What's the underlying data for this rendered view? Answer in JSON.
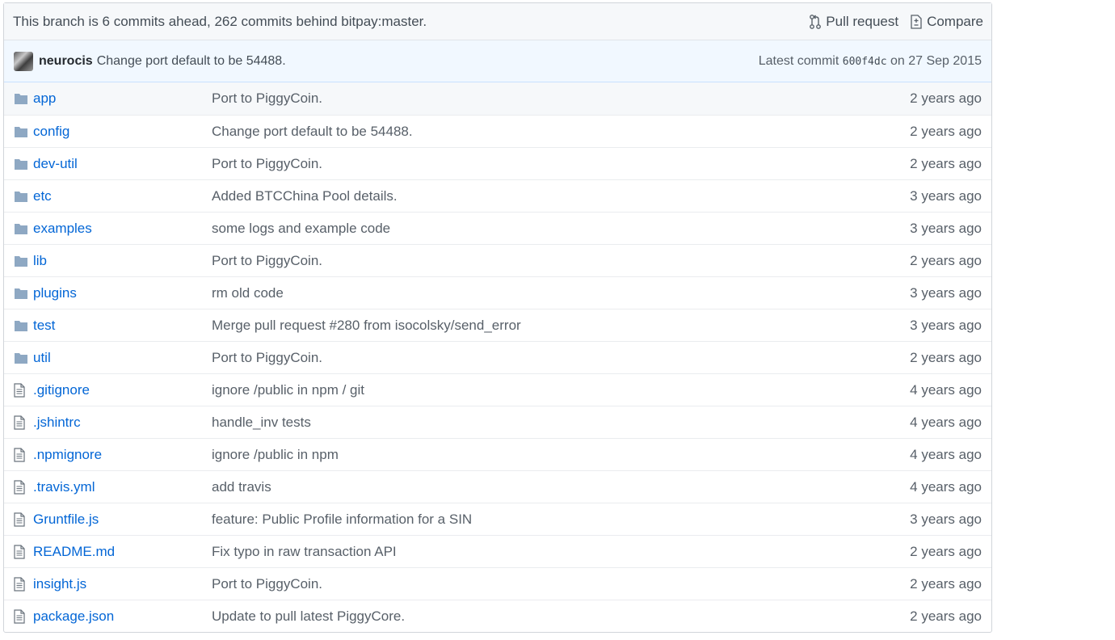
{
  "branch_bar": {
    "status": "This branch is 6 commits ahead, 262 commits behind bitpay:master.",
    "pull_request_label": "Pull request",
    "compare_label": "Compare"
  },
  "commit_bar": {
    "author": "neurocis",
    "message": "Change port default to be 54488.",
    "latest_prefix": "Latest commit",
    "sha": "600f4dc",
    "date_text": "on 27 Sep 2015"
  },
  "files": [
    {
      "name": "app",
      "type": "folder",
      "message": "Port to PiggyCoin.",
      "age": "2 years ago"
    },
    {
      "name": "config",
      "type": "folder",
      "message": "Change port default to be 54488.",
      "age": "2 years ago"
    },
    {
      "name": "dev-util",
      "type": "folder",
      "message": "Port to PiggyCoin.",
      "age": "2 years ago"
    },
    {
      "name": "etc",
      "type": "folder",
      "message": "Added BTCChina Pool details.",
      "age": "3 years ago"
    },
    {
      "name": "examples",
      "type": "folder",
      "message": "some logs and example code",
      "age": "3 years ago"
    },
    {
      "name": "lib",
      "type": "folder",
      "message": "Port to PiggyCoin.",
      "age": "2 years ago"
    },
    {
      "name": "plugins",
      "type": "folder",
      "message": "rm old code",
      "age": "3 years ago"
    },
    {
      "name": "test",
      "type": "folder",
      "message": "Merge pull request #280 from isocolsky/send_error",
      "age": "3 years ago"
    },
    {
      "name": "util",
      "type": "folder",
      "message": "Port to PiggyCoin.",
      "age": "2 years ago"
    },
    {
      "name": ".gitignore",
      "type": "file",
      "message": "ignore /public in npm / git",
      "age": "4 years ago"
    },
    {
      "name": ".jshintrc",
      "type": "file",
      "message": "handle_inv tests",
      "age": "4 years ago"
    },
    {
      "name": ".npmignore",
      "type": "file",
      "message": "ignore /public in npm",
      "age": "4 years ago"
    },
    {
      "name": ".travis.yml",
      "type": "file",
      "message": "add travis",
      "age": "4 years ago"
    },
    {
      "name": "Gruntfile.js",
      "type": "file",
      "message": "feature: Public Profile information for a SIN",
      "age": "3 years ago"
    },
    {
      "name": "README.md",
      "type": "file",
      "message": "Fix typo in raw transaction API",
      "age": "2 years ago"
    },
    {
      "name": "insight.js",
      "type": "file",
      "message": "Port to PiggyCoin.",
      "age": "2 years ago"
    },
    {
      "name": "package.json",
      "type": "file",
      "message": "Update to pull latest PiggyCore.",
      "age": "2 years ago"
    }
  ],
  "colors": {
    "link": "#0366d6",
    "folder_icon": "#79b8ff",
    "file_icon": "#6a737d",
    "commit_bar_bg": "#f1f8ff"
  }
}
